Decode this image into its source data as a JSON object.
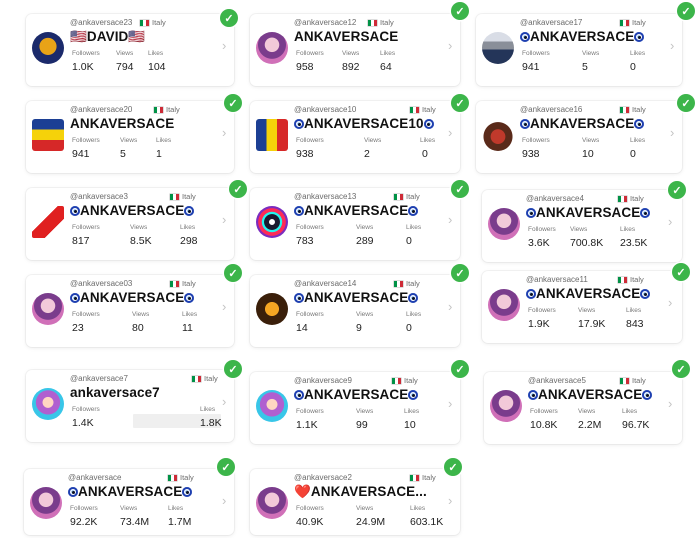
{
  "labels": {
    "followers": "Followers",
    "views": "Views",
    "likes": "Likes"
  },
  "country": "Italy",
  "cards": [
    {
      "handle": "@ankaversace23",
      "name": "🇺🇸DAVID🇺🇸",
      "followers": "1.0K",
      "views": "794",
      "likes": "104"
    },
    {
      "handle": "@ankaversace12",
      "name": "ANKAVERSACE",
      "followers": "958",
      "views": "892",
      "likes": "64"
    },
    {
      "handle": "@ankaversace17",
      "name": "ANKAVERSACE",
      "followers": "941",
      "views": "5",
      "likes": "0"
    },
    {
      "handle": "@ankaversace20",
      "name": "ANKAVERSACE",
      "followers": "941",
      "views": "5",
      "likes": "1"
    },
    {
      "handle": "@ankaversace10",
      "name": "ANKAVERSACE10",
      "followers": "938",
      "views": "2",
      "likes": "0"
    },
    {
      "handle": "@ankaversace16",
      "name": "ANKAVERSACE",
      "followers": "938",
      "views": "10",
      "likes": "0"
    },
    {
      "handle": "@ankaversace3",
      "name": "ANKAVERSACE",
      "followers": "817",
      "views": "8.5K",
      "likes": "298"
    },
    {
      "handle": "@ankaversace13",
      "name": "ANKAVERSACE",
      "followers": "783",
      "views": "289",
      "likes": "0"
    },
    {
      "handle": "@ankaversace4",
      "name": "ANKAVERSACE",
      "followers": "3.6K",
      "views": "700.8K",
      "likes": "23.5K"
    },
    {
      "handle": "@ankaversace03",
      "name": "ANKAVERSACE",
      "followers": "23",
      "views": "80",
      "likes": "11"
    },
    {
      "handle": "@ankaversace14",
      "name": "ANKAVERSACE",
      "followers": "14",
      "views": "9",
      "likes": "0"
    },
    {
      "handle": "@ankaversace11",
      "name": "ANKAVERSACE",
      "followers": "1.9K",
      "views": "17.9K",
      "likes": "843"
    },
    {
      "handle": "@ankaversace7",
      "name": "ankaversace7",
      "followers": "1.4K",
      "views": "",
      "likes": "1.8K"
    },
    {
      "handle": "@ankaversace9",
      "name": "ANKAVERSACE",
      "followers": "1.1K",
      "views": "99",
      "likes": "10"
    },
    {
      "handle": "@ankaversace5",
      "name": "ANKAVERSACE",
      "followers": "10.8K",
      "views": "2.2M",
      "likes": "96.7K"
    },
    {
      "handle": "@ankaversace",
      "name": "ANKAVERSACE",
      "followers": "92.2K",
      "views": "73.4M",
      "likes": "1.7M"
    },
    {
      "handle": "@ankaversace2",
      "name": "❤️ANKAVERSACE...",
      "followers": "40.9K",
      "views": "24.9M",
      "likes": "603.1K"
    }
  ],
  "icons": {
    "verified": "green-check-icon",
    "chevron": "chevron-right-icon",
    "eye": "nazar-eye-icon",
    "flag": "italy-flag-icon"
  },
  "colors": {
    "verified": "#3cb54a",
    "eye": "#1e3fb0"
  }
}
